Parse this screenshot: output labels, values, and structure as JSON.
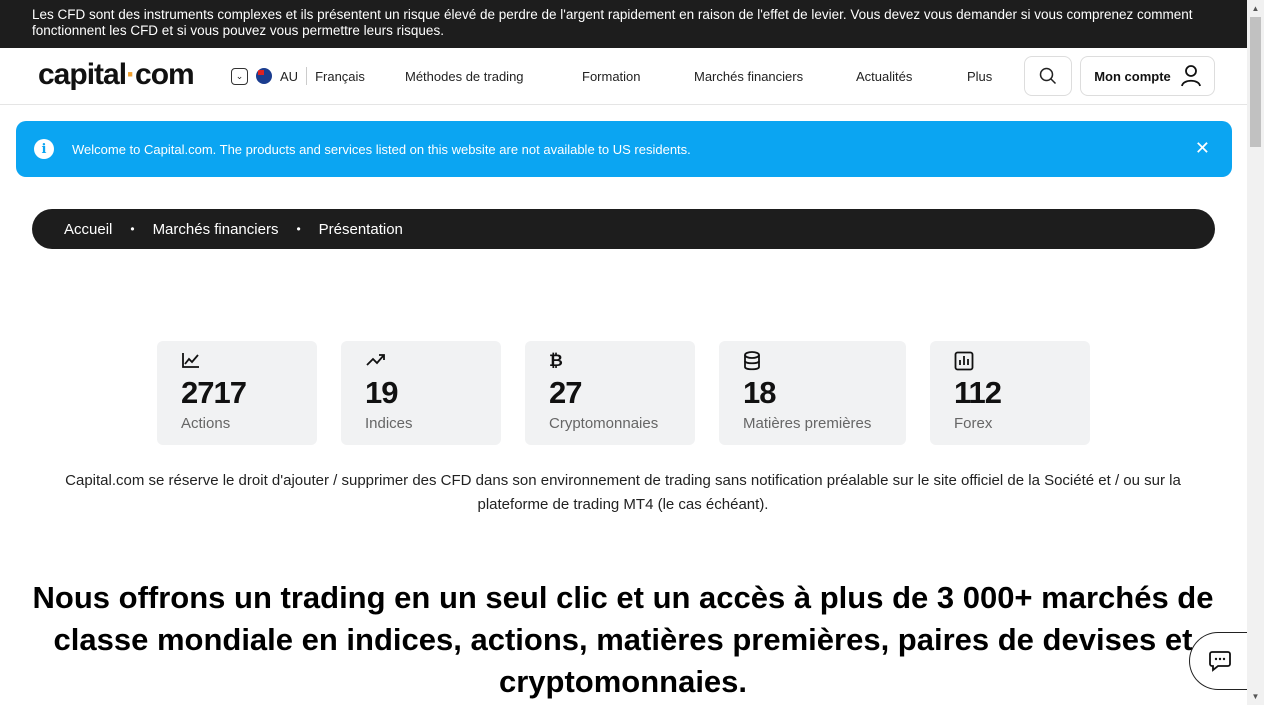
{
  "risk_warning": "Les CFD sont des instruments complexes et ils présentent un risque élevé de perdre de l'argent rapidement en raison de l'effet de levier. Vous devez vous demander si vous comprenez comment fonctionnent les CFD et si vous pouvez vous permettre leurs risques.",
  "header": {
    "logo_left": "capital",
    "logo_dot": "·",
    "logo_right": "com",
    "region_code": "AU",
    "language": "Français",
    "nav": [
      "Méthodes de trading",
      "Formation",
      "Marchés financiers",
      "Actualités",
      "Plus"
    ],
    "account_label": "Mon compte",
    "icons": {
      "search": "search-icon",
      "user": "user-icon",
      "region": "chevron-down-icon",
      "flag": "australia-flag-icon"
    }
  },
  "notice": {
    "text": "Welcome to Capital.com. The products and services listed on this website are not available to US residents.",
    "close": "✕",
    "color": "#0ba5f2"
  },
  "breadcrumb": [
    "Accueil",
    "Marchés financiers",
    "Présentation"
  ],
  "stats": [
    {
      "icon": "line-chart-icon",
      "value": "2717",
      "label": "Actions"
    },
    {
      "icon": "trending-up-icon",
      "value": "19",
      "label": "Indices"
    },
    {
      "icon": "bitcoin-icon",
      "value": "27",
      "label": "Cryptomonnaies"
    },
    {
      "icon": "coins-stack-icon",
      "value": "18",
      "label": "Matières premières"
    },
    {
      "icon": "bar-chart-icon",
      "value": "112",
      "label": "Forex"
    }
  ],
  "disclaimer": "Capital.com se réserve le droit d'ajouter / supprimer des CFD dans son environnement de trading sans notification préalable sur le site officiel de la Société et / ou sur la plateforme de trading MT4 (le cas échéant).",
  "headline": "Nous offrons un trading en un seul clic et un accès à plus de 3 000+ marchés de classe mondiale en indices, actions, matières premières, paires de devises et cryptomonnaies.",
  "colors": {
    "dark": "#1d1d1d",
    "accent": "#0ba5f2",
    "card": "#f1f2f3"
  }
}
